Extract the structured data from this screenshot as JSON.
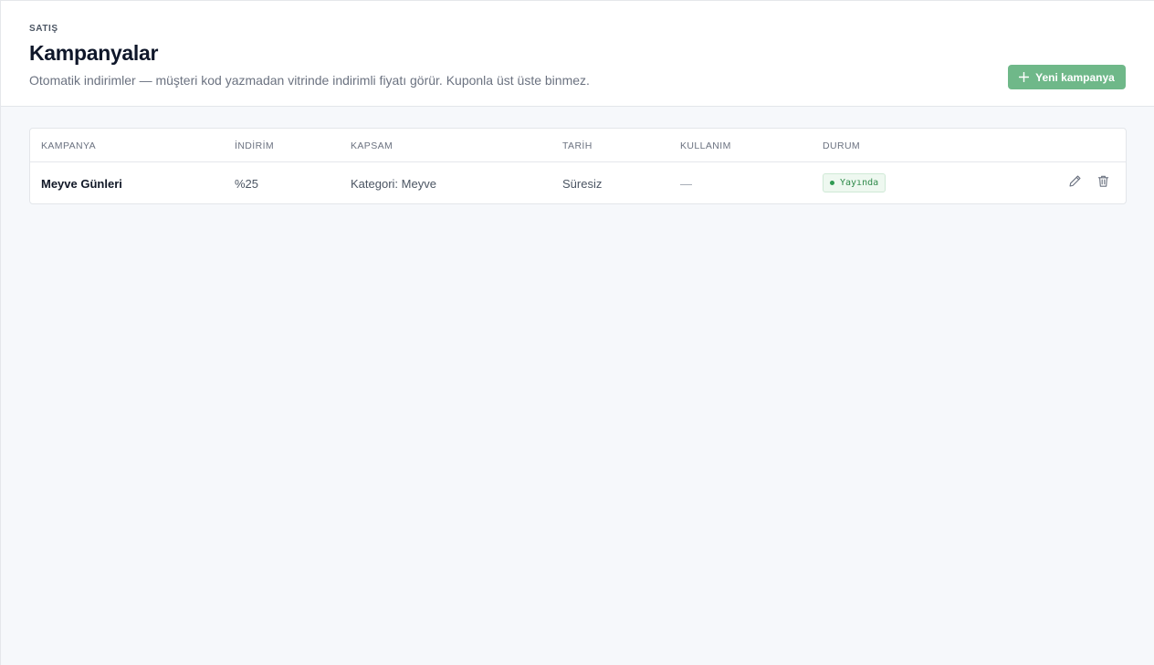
{
  "header": {
    "eyebrow": "SATIŞ",
    "title": "Kampanyalar",
    "subtitle": "Otomatik indirimler — müşteri kod yazmadan vitrinde indirimli fiyatı görür. Kuponla üst üste binmez.",
    "new_button_label": "Yeni kampanya"
  },
  "table": {
    "columns": [
      "KAMPANYA",
      "İNDİRİM",
      "KAPSAM",
      "TARİH",
      "KULLANIM",
      "DURUM"
    ],
    "rows": [
      {
        "name": "Meyve Günleri",
        "discount": "%25",
        "scope": "Kategori: Meyve",
        "date": "Süresiz",
        "usage": "—",
        "status": "Yayında"
      }
    ]
  },
  "colors": {
    "accent": "#6fb889",
    "status_live": "#2f8a4a",
    "background": "#f6f8fb"
  },
  "icons": {
    "new_button": "plus-icon",
    "edit": "pencil-icon",
    "delete": "trash-icon",
    "status": "dot-icon"
  }
}
